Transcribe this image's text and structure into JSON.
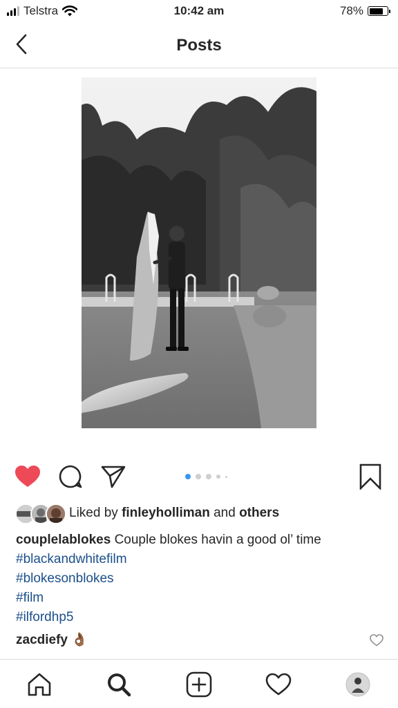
{
  "status_bar": {
    "carrier": "Telstra",
    "time": "10:42 am",
    "battery": "78%",
    "battery_level": 0.78,
    "icons": [
      "signal-icon",
      "wifi-icon",
      "battery-icon"
    ]
  },
  "header": {
    "title": "Posts",
    "back_icon": "chevron-left-icon"
  },
  "post": {
    "image_description_icon": "photo",
    "carousel": {
      "count": 5,
      "active_index": 0
    },
    "liked_by": {
      "prefix": "Liked by",
      "user": "finleyholliman",
      "joiner": "and",
      "others": "others"
    },
    "caption": {
      "user": "couplelablokes",
      "text": "Couple blokes havin a good ol’ time",
      "hashtags": [
        "#blackandwhitefilm",
        "#blokesonblokes",
        "#film",
        "#ilfordhp5"
      ]
    },
    "comment": {
      "user": "zacdiefy",
      "emoji": "👌🏾"
    }
  },
  "tab_bar": {
    "items": [
      "home-icon",
      "search-icon",
      "add-post-icon",
      "activity-heart-icon",
      "profile-avatar"
    ]
  },
  "colors": {
    "like_red": "#ed4956",
    "hashtag_blue": "#1b4f8a",
    "active_dot": "#3897f0"
  }
}
